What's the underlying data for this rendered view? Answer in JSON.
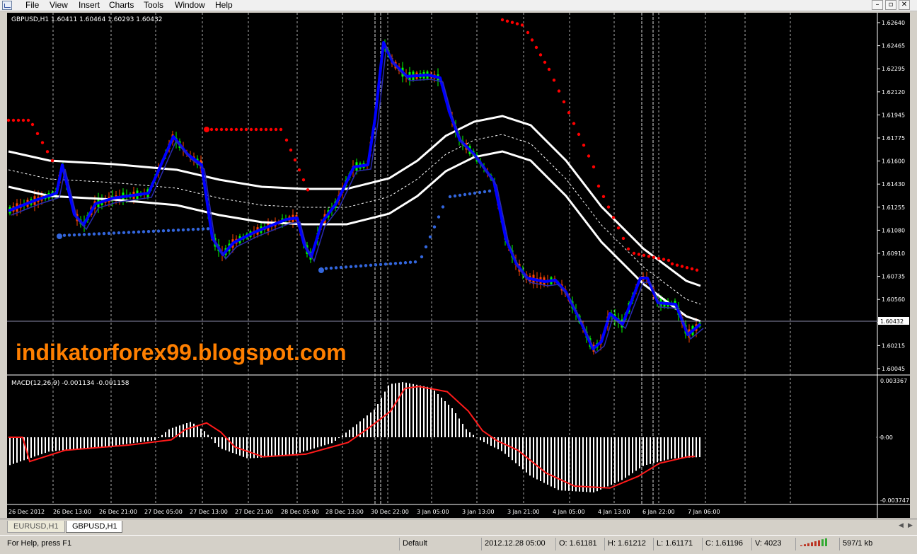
{
  "window": {
    "controls": [
      "–",
      "▫",
      "✕"
    ]
  },
  "menu": [
    "File",
    "View",
    "Insert",
    "Charts",
    "Tools",
    "Window",
    "Help"
  ],
  "main_chart": {
    "title": "GBPUSD,H1  1.60411 1.60464 1.60293 1.60432",
    "current_price": "1.60432",
    "price_axis": [
      "1.62640",
      "1.62465",
      "1.62295",
      "1.62120",
      "1.61945",
      "1.61775",
      "1.61600",
      "1.61430",
      "1.61255",
      "1.61080",
      "1.60910",
      "1.60735",
      "1.60560",
      "1.60390",
      "1.60215",
      "1.60045"
    ],
    "watermark": "indikatorforex99.blogspot.com"
  },
  "macd": {
    "title": "MACD(12,26,9) -0.001134 -0.001158",
    "axis": [
      "0.003367",
      "0.00",
      "-0.003747"
    ]
  },
  "time_axis": [
    "26 Dec 2012",
    "26 Dec 13:00",
    "26 Dec 21:00",
    "27 Dec 05:00",
    "27 Dec 13:00",
    "27 Dec 21:00",
    "28 Dec 05:00",
    "28 Dec 13:00",
    "30 Dec 22:00",
    "3 Jan 05:00",
    "3 Jan 13:00",
    "3 Jan 21:00",
    "4 Jan 05:00",
    "4 Jan 13:00",
    "6 Jan 22:00",
    "7 Jan 06:00"
  ],
  "tabs": [
    {
      "label": "EURUSD,H1",
      "active": false
    },
    {
      "label": "GBPUSD,H1",
      "active": true
    }
  ],
  "status": {
    "help": "For Help, press F1",
    "profile": "Default",
    "datetime": "2012.12.28 05:00",
    "open": "O: 1.61181",
    "high": "H: 1.61212",
    "low": "L: 1.61171",
    "close": "C: 1.61196",
    "volume": "V: 4023",
    "traffic": "597/1 kb"
  },
  "colors": {
    "background": "#000000",
    "price_line": "#0000ff",
    "sar_up": "#ff0000",
    "sar_down": "#3366dd",
    "bands": "#ffffff",
    "candle_up": "#00ff00",
    "candle_down": "#ff4500",
    "watermark": "#ff7f00"
  }
}
